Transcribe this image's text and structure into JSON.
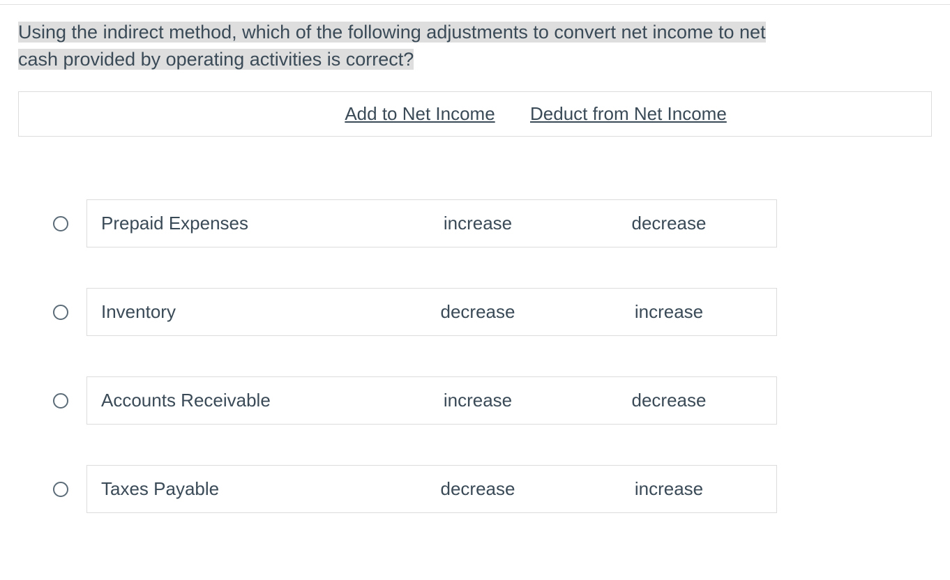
{
  "question": {
    "line1": "Using the indirect method, which of the following adjustments to convert net income to net",
    "line2": "cash provided by operating activities is correct?"
  },
  "headers": {
    "add": "Add to Net Income",
    "deduct": "Deduct from Net Income"
  },
  "options": [
    {
      "label": "Prepaid Expenses",
      "add": "increase",
      "deduct": "decrease"
    },
    {
      "label": "Inventory",
      "add": "decrease",
      "deduct": "increase"
    },
    {
      "label": "Accounts Receivable",
      "add": "increase",
      "deduct": "decrease"
    },
    {
      "label": "Taxes Payable",
      "add": "decrease",
      "deduct": "increase"
    }
  ]
}
